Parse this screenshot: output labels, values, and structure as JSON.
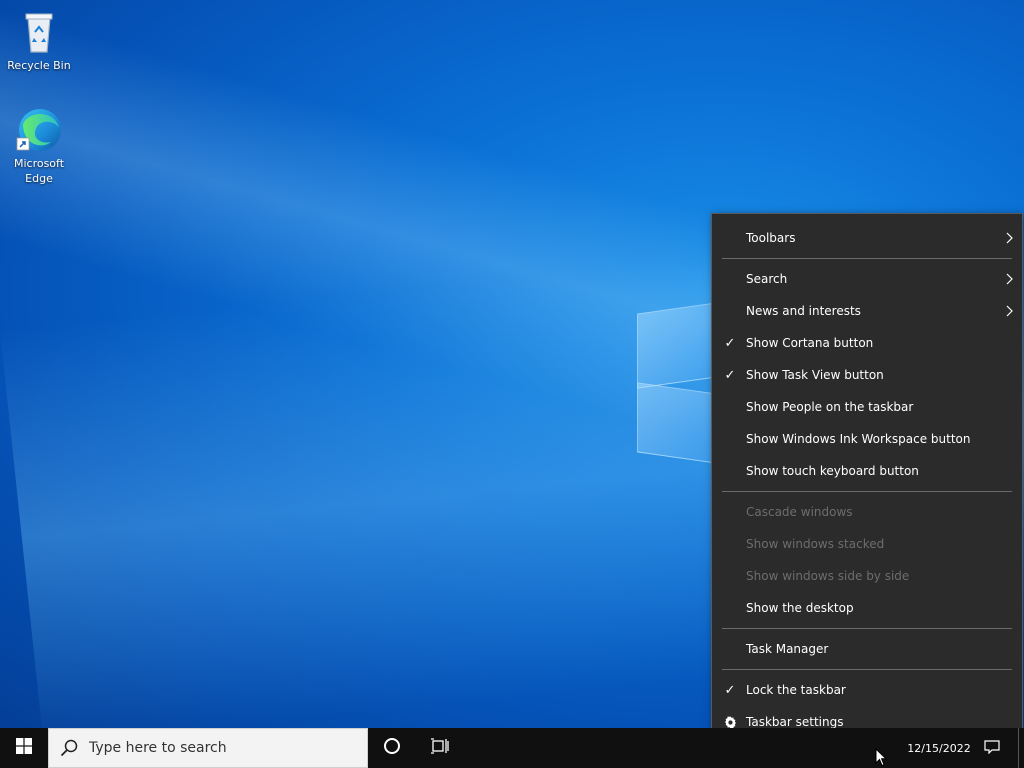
{
  "desktop": {
    "icons": [
      {
        "label": "Recycle Bin",
        "icon": "recycle-bin-icon"
      },
      {
        "label": "Microsoft Edge",
        "icon": "edge-icon"
      }
    ]
  },
  "taskbar": {
    "search_placeholder": "Type here to search",
    "clock_date": "12/15/2022",
    "start_icon": "windows-start-icon",
    "cortana_icon": "cortana-circle-icon",
    "taskview_icon": "task-view-icon",
    "notification_icon": "notification-icon"
  },
  "context_menu": {
    "items": [
      {
        "label": "Toolbars",
        "submenu": true
      },
      {
        "label": "Search",
        "submenu": true
      },
      {
        "label": "News and interests",
        "submenu": true
      },
      {
        "label": "Show Cortana button",
        "checked": true
      },
      {
        "label": "Show Task View button",
        "checked": true
      },
      {
        "label": "Show People on the taskbar"
      },
      {
        "label": "Show Windows Ink Workspace button"
      },
      {
        "label": "Show touch keyboard button"
      },
      {
        "label": "Cascade windows",
        "disabled": true
      },
      {
        "label": "Show windows stacked",
        "disabled": true
      },
      {
        "label": "Show windows side by side",
        "disabled": true
      },
      {
        "label": "Show the desktop"
      },
      {
        "label": "Task Manager"
      },
      {
        "label": "Lock the taskbar",
        "checked": true
      },
      {
        "label": "Taskbar settings",
        "icon": "gear-icon"
      }
    ]
  },
  "colors": {
    "menu_bg": "#2b2b2b",
    "taskbar_bg": "#101010",
    "disabled_text": "#6d6d6d"
  }
}
